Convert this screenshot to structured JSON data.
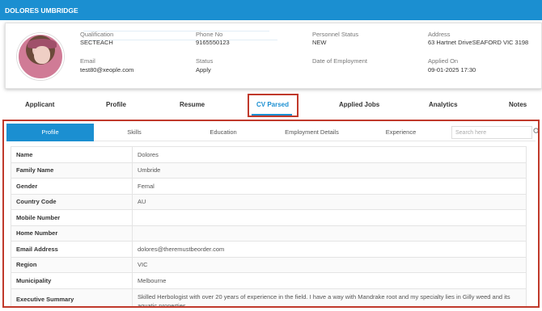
{
  "header": {
    "title": "DOLORES UMBRIDGE"
  },
  "profile": {
    "qualification_label": "Qualification",
    "qualification_value": "SECTEACH",
    "phone_label": "Phone No",
    "phone_value": "9165550123",
    "personnel_status_label": "Personnel Status",
    "personnel_status_value": "NEW",
    "address_label": "Address",
    "address_value": "63 Hartnet DriveSEAFORD VIC 3198",
    "email_label": "Email",
    "email_value": "test80@xeople.com",
    "status_label": "Status",
    "status_value": "Apply",
    "date_employment_label": "Date of Employment",
    "date_employment_value": "",
    "applied_on_label": "Applied On",
    "applied_on_value": "09-01-2025 17:30"
  },
  "tabs": [
    {
      "label": "Applicant"
    },
    {
      "label": "Profile"
    },
    {
      "label": "Resume"
    },
    {
      "label": "CV Parsed"
    },
    {
      "label": "Applied Jobs"
    },
    {
      "label": "Analytics"
    },
    {
      "label": "Notes"
    }
  ],
  "subtabs": [
    {
      "label": "Profile"
    },
    {
      "label": "Skills"
    },
    {
      "label": "Education"
    },
    {
      "label": "Employment Details"
    },
    {
      "label": "Experience"
    }
  ],
  "search": {
    "placeholder": "Search here"
  },
  "rows": [
    {
      "key": "Name",
      "value": "Dolores"
    },
    {
      "key": "Family Name",
      "value": "Umbride"
    },
    {
      "key": "Gender",
      "value": "Femal"
    },
    {
      "key": "Country Code",
      "value": "AU"
    },
    {
      "key": "Mobile Number",
      "value": ""
    },
    {
      "key": "Home Number",
      "value": ""
    },
    {
      "key": "Email Address",
      "value": "dolores@theremustbeorder.com"
    },
    {
      "key": "Region",
      "value": "VIC"
    },
    {
      "key": "Municipality",
      "value": "Melbourne"
    },
    {
      "key": "Executive Summary",
      "value": "Skilled Herbologist with over 20 years of experience in the field. I have a way with Mandrake root and my specialty lies in Gilly weed and its aquatic properties"
    }
  ],
  "colors": {
    "accent": "#1b8fd1",
    "highlight": "#c0392b"
  }
}
